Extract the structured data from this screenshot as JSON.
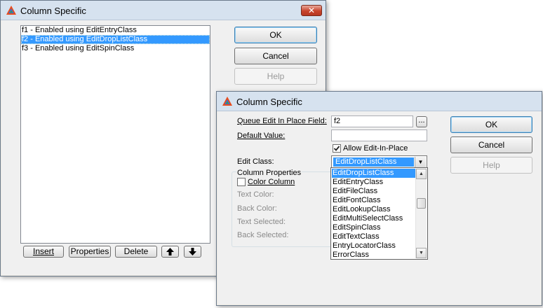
{
  "window1": {
    "title": "Column Specific",
    "list_items": [
      "f1 - Enabled using EditEntryClass",
      "f2 - Enabled using EditDropListClass",
      "f3 - Enabled using EditSpinClass"
    ],
    "selected_index": 1,
    "buttons": {
      "ok": "OK",
      "cancel": "Cancel",
      "help": "Help"
    },
    "bottom_buttons": {
      "insert": "Insert",
      "properties": "Properties",
      "delete": "Delete"
    }
  },
  "window2": {
    "title": "Column Specific",
    "queue_field_label": "Queue Edit In Place Field:",
    "queue_field_value": "f2",
    "browse_label": "...",
    "default_value_label": "Default Value:",
    "default_value": "",
    "allow_edit_label": "Allow Edit-In-Place",
    "allow_edit_checked": true,
    "edit_class_label": "Edit Class:",
    "edit_class_value": "EditDropListClass",
    "column_properties_label": "Column Properties",
    "color_column_label": "Color Column",
    "text_color_label": "Text Color:",
    "back_color_label": "Back Color:",
    "text_selected_label": "Text Selected:",
    "back_selected_label": "Back Selected:",
    "buttons": {
      "ok": "OK",
      "cancel": "Cancel",
      "help": "Help"
    },
    "dropdown_items": [
      "EditDropListClass",
      "EditEntryClass",
      "EditFileClass",
      "EditFontClass",
      "EditLookupClass",
      "EditMultiSelectClass",
      "EditSpinClass",
      "EditTextClass",
      "EntryLocatorClass",
      "ErrorClass"
    ],
    "dropdown_selected_index": 0
  },
  "colors": {
    "selection": "#3399ff",
    "close_button": "#c8442c",
    "titlebar": "#d6e2ef"
  }
}
